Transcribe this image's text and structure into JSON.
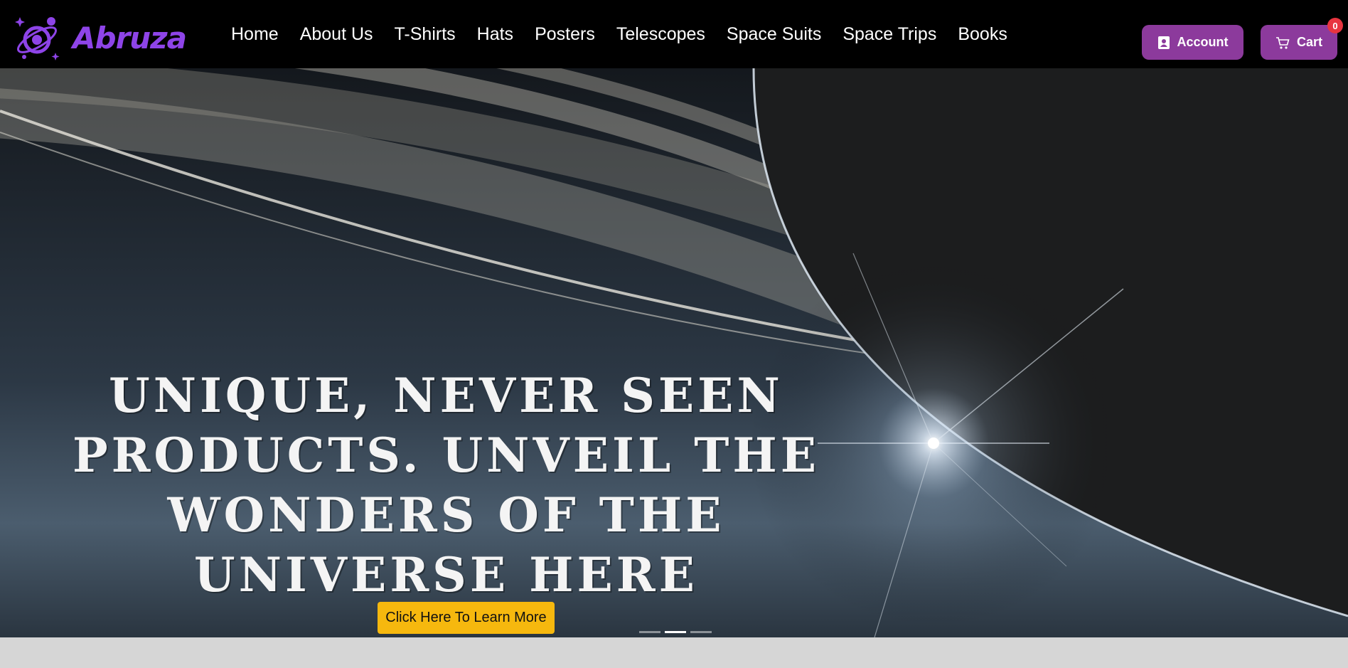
{
  "brand": {
    "name": "Abruza",
    "color": "#8e44e8",
    "icon": "planet-logo-icon"
  },
  "nav": {
    "items": [
      {
        "label": "Home"
      },
      {
        "label": "About Us"
      },
      {
        "label": "T-Shirts"
      },
      {
        "label": "Hats"
      },
      {
        "label": "Posters"
      },
      {
        "label": "Telescopes"
      },
      {
        "label": "Space Suits"
      },
      {
        "label": "Space Trips"
      },
      {
        "label": "Books"
      }
    ]
  },
  "header_actions": {
    "account_label": "Account",
    "account_icon": "contact-card-icon",
    "cart_label": "Cart",
    "cart_icon": "shopping-cart-icon",
    "cart_count": "0",
    "button_color": "#8c3a9c",
    "badge_color": "#e8343f"
  },
  "hero": {
    "headline": "Unique, never seen products. Unveil the wonders of the universe here",
    "cta_label": "Click Here To Learn More",
    "cta_color": "#f6b80e",
    "slides_total": 3,
    "active_slide": 2
  }
}
